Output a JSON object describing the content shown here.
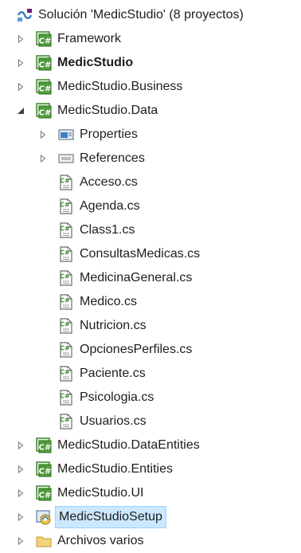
{
  "solution": {
    "label": "Solución 'MedicStudio'  (8 proyectos)",
    "icon": "solution-icon"
  },
  "items": [
    {
      "id": "framework",
      "label": "Framework",
      "level": 1,
      "icon": "csharp-project-icon",
      "expander": "collapsed",
      "bold": false,
      "selected": false
    },
    {
      "id": "medicstudio",
      "label": "MedicStudio",
      "level": 1,
      "icon": "csharp-project-icon",
      "expander": "collapsed",
      "bold": true,
      "selected": false
    },
    {
      "id": "business",
      "label": "MedicStudio.Business",
      "level": 1,
      "icon": "csharp-project-icon",
      "expander": "collapsed",
      "bold": false,
      "selected": false
    },
    {
      "id": "data",
      "label": "MedicStudio.Data",
      "level": 1,
      "icon": "csharp-project-icon",
      "expander": "expanded",
      "bold": false,
      "selected": false
    },
    {
      "id": "properties",
      "label": "Properties",
      "level": 2,
      "icon": "properties-icon",
      "expander": "collapsed",
      "bold": false,
      "selected": false
    },
    {
      "id": "references",
      "label": "References",
      "level": 2,
      "icon": "references-icon",
      "expander": "collapsed",
      "bold": false,
      "selected": false
    },
    {
      "id": "acceso",
      "label": "Acceso.cs",
      "level": 2,
      "icon": "csharp-file-icon",
      "expander": "none",
      "bold": false,
      "selected": false
    },
    {
      "id": "agenda",
      "label": "Agenda.cs",
      "level": 2,
      "icon": "csharp-file-icon",
      "expander": "none",
      "bold": false,
      "selected": false
    },
    {
      "id": "class1",
      "label": "Class1.cs",
      "level": 2,
      "icon": "csharp-file-icon",
      "expander": "none",
      "bold": false,
      "selected": false
    },
    {
      "id": "consultas",
      "label": "ConsultasMedicas.cs",
      "level": 2,
      "icon": "csharp-file-icon",
      "expander": "none",
      "bold": false,
      "selected": false
    },
    {
      "id": "medicina",
      "label": "MedicinaGeneral.cs",
      "level": 2,
      "icon": "csharp-file-icon",
      "expander": "none",
      "bold": false,
      "selected": false
    },
    {
      "id": "medico",
      "label": "Medico.cs",
      "level": 2,
      "icon": "csharp-file-icon",
      "expander": "none",
      "bold": false,
      "selected": false
    },
    {
      "id": "nutricion",
      "label": "Nutricion.cs",
      "level": 2,
      "icon": "csharp-file-icon",
      "expander": "none",
      "bold": false,
      "selected": false
    },
    {
      "id": "opciones",
      "label": "OpcionesPerfiles.cs",
      "level": 2,
      "icon": "csharp-file-icon",
      "expander": "none",
      "bold": false,
      "selected": false
    },
    {
      "id": "paciente",
      "label": "Paciente.cs",
      "level": 2,
      "icon": "csharp-file-icon",
      "expander": "none",
      "bold": false,
      "selected": false
    },
    {
      "id": "psicologia",
      "label": "Psicologia.cs",
      "level": 2,
      "icon": "csharp-file-icon",
      "expander": "none",
      "bold": false,
      "selected": false
    },
    {
      "id": "usuarios",
      "label": "Usuarios.cs",
      "level": 2,
      "icon": "csharp-file-icon",
      "expander": "none",
      "bold": false,
      "selected": false
    },
    {
      "id": "dataentities",
      "label": "MedicStudio.DataEntities",
      "level": 1,
      "icon": "csharp-project-icon",
      "expander": "collapsed",
      "bold": false,
      "selected": false
    },
    {
      "id": "entities",
      "label": "MedicStudio.Entities",
      "level": 1,
      "icon": "csharp-project-icon",
      "expander": "collapsed",
      "bold": false,
      "selected": false
    },
    {
      "id": "ui",
      "label": "MedicStudio.UI",
      "level": 1,
      "icon": "csharp-project-icon",
      "expander": "collapsed",
      "bold": false,
      "selected": false
    },
    {
      "id": "setup",
      "label": "MedicStudioSetup",
      "level": 1,
      "icon": "setup-project-icon",
      "expander": "collapsed",
      "bold": false,
      "selected": true
    },
    {
      "id": "archivos",
      "label": "Archivos varios",
      "level": 1,
      "icon": "folder-icon",
      "expander": "collapsed",
      "bold": false,
      "selected": false
    }
  ],
  "colors": {
    "text": "#1e1e1e",
    "selection_bg": "#cce8ff",
    "selection_border": "#99d1ff",
    "csharp_green": "#3c8a2e",
    "expander": "#7a7a7a"
  }
}
